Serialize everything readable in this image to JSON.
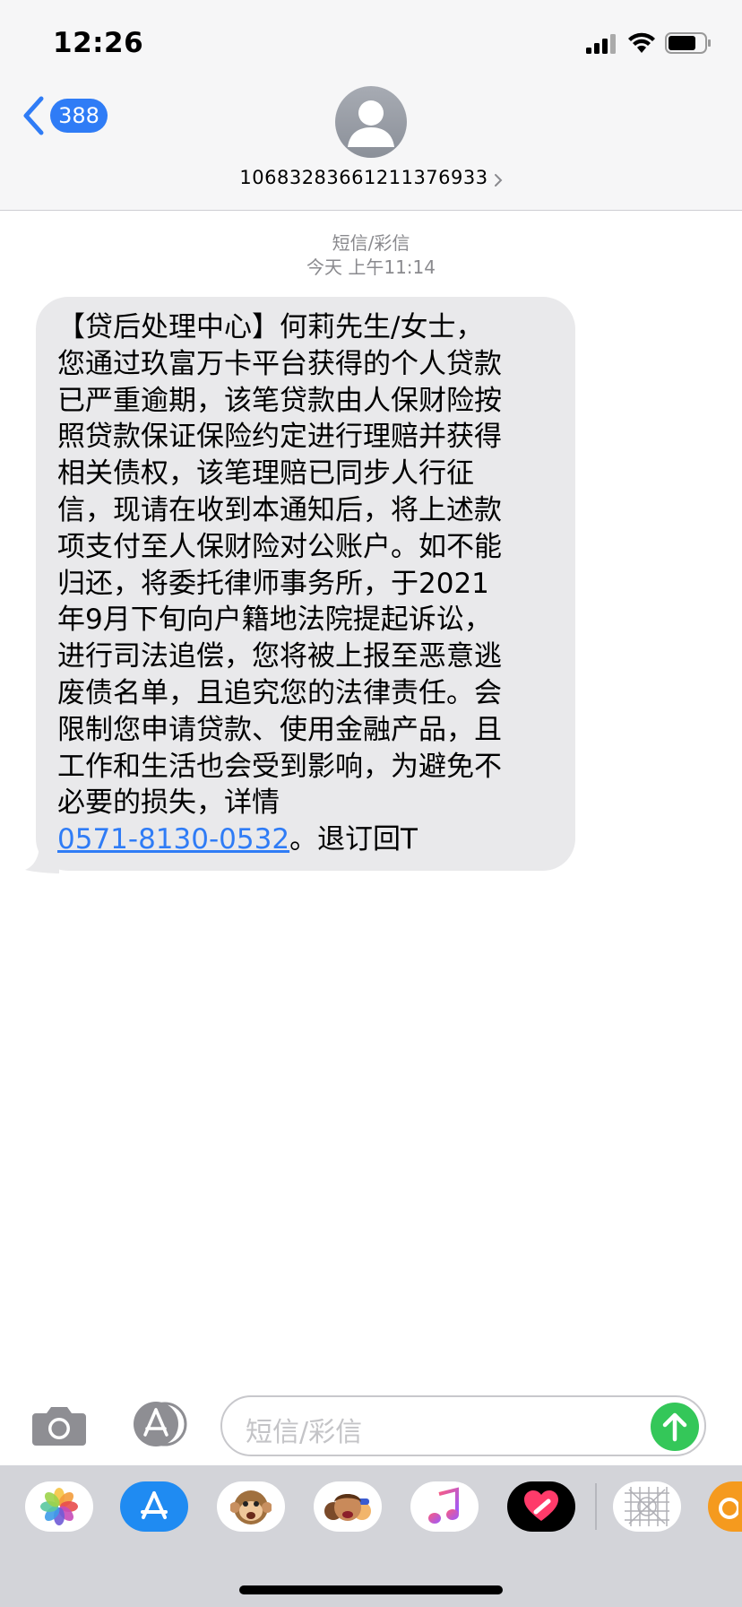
{
  "status_bar": {
    "time": "12:26"
  },
  "nav": {
    "unread_count": "388",
    "contact_number": "10683283661211376933"
  },
  "conversation": {
    "service": "短信/彩信",
    "timestamp": "今天 上午11:14",
    "message": {
      "text": "【贷后处理中心】何莉先生/女士，\n您通过玖富万卡平台获得的个人贷款\n已严重逾期，该笔贷款由人保财险按\n照贷款保证保险约定进行理赔并获得\n相关债权，该笔理赔已同步人行征\n信，现请在收到本通知后，将上述款\n项支付至人保财险对公账户。如不能\n归还，将委托律师事务所，于2021\n年9月下旬向户籍地法院提起诉讼，\n进行司法追偿，您将被上报至恶意逃\n废债名单，且追究您的法律责任。会\n限制您申请贷款、使用金融产品，且\n工作和生活也会受到影响，为避免不\n必要的损失，详情\n",
      "link": "0571-8130-0532",
      "suffix": "。退订回T"
    }
  },
  "compose": {
    "placeholder": "短信/彩信"
  },
  "drawer": {
    "apps": [
      "photos-icon",
      "app-store-icon",
      "animoji-monkey-icon",
      "memoji-icon",
      "music-icon",
      "digital-touch-icon",
      "grid-app-icon",
      "partial-app-icon"
    ]
  },
  "colors": {
    "accent": "#2f7cf6",
    "send": "#34c759",
    "bubble": "#e9e9eb"
  }
}
